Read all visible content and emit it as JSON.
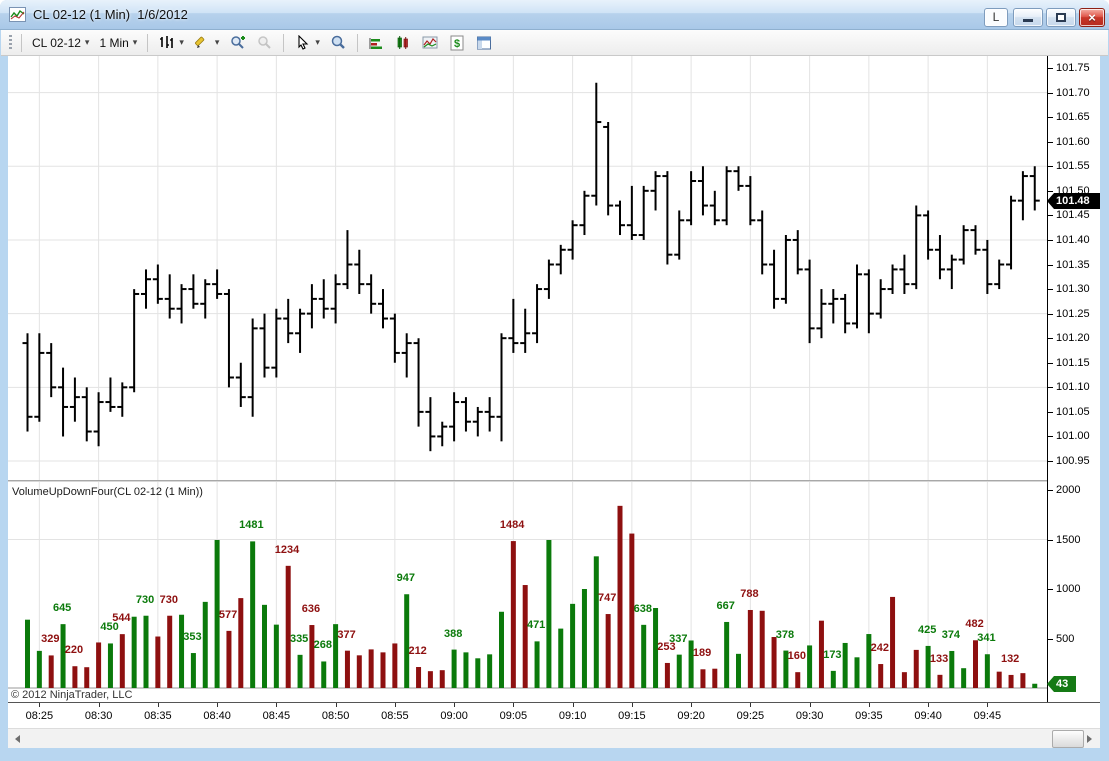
{
  "window": {
    "title": "CL 02-12 (1 Min)  1/6/2012",
    "controls": {
      "link_label": "L",
      "close_glyph": "×"
    }
  },
  "toolbar": {
    "instrument": "CL 02-12",
    "interval": "1 Min",
    "caret": "▾",
    "icons": [
      "bar-type",
      "drawing-pencil",
      "zoom-in",
      "zoom-out",
      "cursor",
      "data-box",
      "indicators",
      "chart-style",
      "chart-region",
      "account-dollar",
      "properties"
    ]
  },
  "volume_panel": {
    "indicator_label": "VolumeUpDownFour(CL 02-12 (1 Min))",
    "copyright": "© 2012 NinjaTrader, LLC"
  },
  "badges": {
    "last_price": "101.48",
    "last_volume": "43"
  },
  "colors": {
    "up": "#0B7A0B",
    "down": "#8E1010",
    "bar": "#000000",
    "grid": "#e3e3e3",
    "price_badge_bg": "#000000",
    "volume_badge_bg": "#157a15"
  },
  "chart_data": {
    "type": "ohlc",
    "title": "CL 02-12 (1 Min)  1/6/2012",
    "price_axis": {
      "min": 100.95,
      "max": 101.75,
      "tick_step": 0.05,
      "grid_step": 0.15,
      "grid_top": 101.7,
      "last_price": 101.48
    },
    "volume_axis": {
      "ticks": [
        500,
        1000,
        1500,
        2000
      ],
      "grid": [
        1500
      ],
      "max": 2000,
      "last_volume": 43
    },
    "time_labels": [
      "08:25",
      "08:30",
      "08:35",
      "08:40",
      "08:45",
      "08:50",
      "08:55",
      "09:00",
      "09:05",
      "09:10",
      "09:15",
      "09:20",
      "09:25",
      "09:30",
      "09:35",
      "09:40",
      "09:45"
    ],
    "bars_note": "o,h,l,c,volume,dir(u=up-green/d=down-red),volume_label",
    "bars": [
      [
        101.19,
        101.21,
        101.01,
        101.04,
        690,
        "u",
        ""
      ],
      [
        101.04,
        101.21,
        101.03,
        101.17,
        375,
        "u",
        ""
      ],
      [
        101.17,
        101.19,
        101.08,
        101.1,
        329,
        "d",
        "329"
      ],
      [
        101.1,
        101.14,
        101.0,
        101.06,
        645,
        "u",
        "645"
      ],
      [
        101.06,
        101.12,
        101.03,
        101.08,
        220,
        "d",
        "220"
      ],
      [
        101.08,
        101.1,
        100.99,
        101.01,
        210,
        "d",
        ""
      ],
      [
        101.01,
        101.09,
        100.98,
        101.07,
        460,
        "d",
        ""
      ],
      [
        101.07,
        101.12,
        101.05,
        101.06,
        450,
        "u",
        "450"
      ],
      [
        101.06,
        101.11,
        101.04,
        101.1,
        544,
        "d",
        "544"
      ],
      [
        101.1,
        101.3,
        101.09,
        101.29,
        720,
        "u",
        ""
      ],
      [
        101.29,
        101.34,
        101.26,
        101.32,
        730,
        "u",
        "730"
      ],
      [
        101.32,
        101.35,
        101.27,
        101.28,
        520,
        "d",
        ""
      ],
      [
        101.28,
        101.33,
        101.24,
        101.26,
        730,
        "d",
        "730"
      ],
      [
        101.26,
        101.31,
        101.23,
        101.3,
        740,
        "u",
        ""
      ],
      [
        101.3,
        101.33,
        101.26,
        101.27,
        353,
        "u",
        "353"
      ],
      [
        101.27,
        101.32,
        101.24,
        101.31,
        870,
        "u",
        ""
      ],
      [
        101.31,
        101.34,
        101.28,
        101.29,
        1495,
        "u",
        ""
      ],
      [
        101.29,
        101.3,
        101.1,
        101.12,
        577,
        "d",
        "577"
      ],
      [
        101.12,
        101.15,
        101.06,
        101.08,
        908,
        "d",
        ""
      ],
      [
        101.08,
        101.24,
        101.04,
        101.22,
        1481,
        "u",
        "1481"
      ],
      [
        101.22,
        101.25,
        101.12,
        101.14,
        840,
        "u",
        ""
      ],
      [
        101.14,
        101.26,
        101.12,
        101.24,
        640,
        "u",
        ""
      ],
      [
        101.24,
        101.28,
        101.19,
        101.21,
        1234,
        "d",
        "1234"
      ],
      [
        101.21,
        101.26,
        101.17,
        101.25,
        335,
        "u",
        "335"
      ],
      [
        101.25,
        101.31,
        101.22,
        101.28,
        636,
        "d",
        "636"
      ],
      [
        101.28,
        101.32,
        101.24,
        101.26,
        268,
        "u",
        "268"
      ],
      [
        101.26,
        101.33,
        101.23,
        101.31,
        645,
        "u",
        ""
      ],
      [
        101.31,
        101.42,
        101.3,
        101.35,
        377,
        "d",
        "377"
      ],
      [
        101.35,
        101.38,
        101.29,
        101.31,
        330,
        "d",
        ""
      ],
      [
        101.31,
        101.33,
        101.25,
        101.27,
        390,
        "d",
        ""
      ],
      [
        101.27,
        101.3,
        101.22,
        101.24,
        360,
        "d",
        ""
      ],
      [
        101.24,
        101.25,
        101.15,
        101.17,
        450,
        "d",
        ""
      ],
      [
        101.17,
        101.21,
        101.12,
        101.19,
        947,
        "u",
        "947"
      ],
      [
        101.19,
        101.2,
        101.02,
        101.05,
        212,
        "d",
        "212"
      ],
      [
        101.05,
        101.08,
        100.97,
        101.0,
        170,
        "d",
        ""
      ],
      [
        101.0,
        101.03,
        100.98,
        101.02,
        180,
        "d",
        ""
      ],
      [
        101.02,
        101.09,
        100.99,
        101.07,
        388,
        "u",
        "388"
      ],
      [
        101.07,
        101.08,
        101.01,
        101.03,
        360,
        "u",
        ""
      ],
      [
        101.03,
        101.06,
        101.0,
        101.05,
        300,
        "u",
        ""
      ],
      [
        101.05,
        101.08,
        101.01,
        101.04,
        340,
        "u",
        ""
      ],
      [
        101.04,
        101.21,
        100.99,
        101.2,
        770,
        "u",
        ""
      ],
      [
        101.2,
        101.28,
        101.17,
        101.19,
        1484,
        "d",
        "1484"
      ],
      [
        101.19,
        101.26,
        101.17,
        101.21,
        1040,
        "d",
        ""
      ],
      [
        101.21,
        101.31,
        101.19,
        101.3,
        471,
        "u",
        "471"
      ],
      [
        101.3,
        101.36,
        101.28,
        101.35,
        1495,
        "u",
        ""
      ],
      [
        101.35,
        101.39,
        101.33,
        101.38,
        600,
        "u",
        ""
      ],
      [
        101.38,
        101.44,
        101.36,
        101.43,
        850,
        "u",
        ""
      ],
      [
        101.43,
        101.5,
        101.41,
        101.49,
        1000,
        "u",
        ""
      ],
      [
        101.49,
        101.72,
        101.47,
        101.64,
        1330,
        "u",
        ""
      ],
      [
        101.63,
        101.64,
        101.45,
        101.47,
        747,
        "d",
        "747"
      ],
      [
        101.47,
        101.48,
        101.41,
        101.43,
        1840,
        "d",
        ""
      ],
      [
        101.43,
        101.51,
        101.4,
        101.41,
        1560,
        "d",
        ""
      ],
      [
        101.41,
        101.51,
        101.4,
        101.5,
        638,
        "u",
        "638"
      ],
      [
        101.5,
        101.54,
        101.46,
        101.53,
        808,
        "u",
        ""
      ],
      [
        101.53,
        101.54,
        101.35,
        101.37,
        253,
        "d",
        "253"
      ],
      [
        101.37,
        101.46,
        101.36,
        101.44,
        337,
        "u",
        "337"
      ],
      [
        101.44,
        101.54,
        101.43,
        101.52,
        480,
        "u",
        ""
      ],
      [
        101.52,
        101.55,
        101.45,
        101.47,
        189,
        "d",
        "189"
      ],
      [
        101.47,
        101.5,
        101.43,
        101.44,
        195,
        "d",
        ""
      ],
      [
        101.44,
        101.55,
        101.43,
        101.54,
        667,
        "u",
        "667"
      ],
      [
        101.54,
        101.55,
        101.5,
        101.51,
        345,
        "u",
        ""
      ],
      [
        101.51,
        101.53,
        101.43,
        101.44,
        788,
        "d",
        "788"
      ],
      [
        101.44,
        101.46,
        101.33,
        101.35,
        780,
        "d",
        ""
      ],
      [
        101.35,
        101.38,
        101.26,
        101.28,
        515,
        "d",
        ""
      ],
      [
        101.28,
        101.41,
        101.27,
        101.4,
        378,
        "u",
        "378"
      ],
      [
        101.4,
        101.42,
        101.33,
        101.34,
        160,
        "d",
        "160"
      ],
      [
        101.34,
        101.36,
        101.19,
        101.22,
        430,
        "u",
        ""
      ],
      [
        101.22,
        101.3,
        101.2,
        101.27,
        680,
        "d",
        ""
      ],
      [
        101.27,
        101.3,
        101.23,
        101.28,
        173,
        "u",
        "173"
      ],
      [
        101.28,
        101.29,
        101.21,
        101.23,
        455,
        "u",
        ""
      ],
      [
        101.23,
        101.35,
        101.22,
        101.33,
        310,
        "u",
        ""
      ],
      [
        101.33,
        101.34,
        101.21,
        101.25,
        545,
        "u",
        ""
      ],
      [
        101.25,
        101.32,
        101.24,
        101.3,
        242,
        "d",
        "242"
      ],
      [
        101.3,
        101.35,
        101.29,
        101.34,
        920,
        "d",
        ""
      ],
      [
        101.34,
        101.37,
        101.29,
        101.31,
        160,
        "d",
        ""
      ],
      [
        101.31,
        101.47,
        101.3,
        101.45,
        385,
        "d",
        ""
      ],
      [
        101.45,
        101.46,
        101.36,
        101.38,
        425,
        "u",
        "425"
      ],
      [
        101.38,
        101.41,
        101.32,
        101.34,
        133,
        "d",
        "133"
      ],
      [
        101.34,
        101.37,
        101.3,
        101.36,
        374,
        "u",
        "374"
      ],
      [
        101.36,
        101.43,
        101.35,
        101.42,
        200,
        "u",
        ""
      ],
      [
        101.42,
        101.43,
        101.37,
        101.38,
        482,
        "d",
        "482"
      ],
      [
        101.38,
        101.4,
        101.29,
        101.31,
        341,
        "u",
        "341"
      ],
      [
        101.31,
        101.36,
        101.3,
        101.35,
        165,
        "d",
        ""
      ],
      [
        101.35,
        101.49,
        101.34,
        101.48,
        132,
        "d",
        "132"
      ],
      [
        101.48,
        101.54,
        101.44,
        101.53,
        150,
        "d",
        ""
      ],
      [
        101.53,
        101.55,
        101.46,
        101.48,
        43,
        "u",
        ""
      ]
    ]
  }
}
